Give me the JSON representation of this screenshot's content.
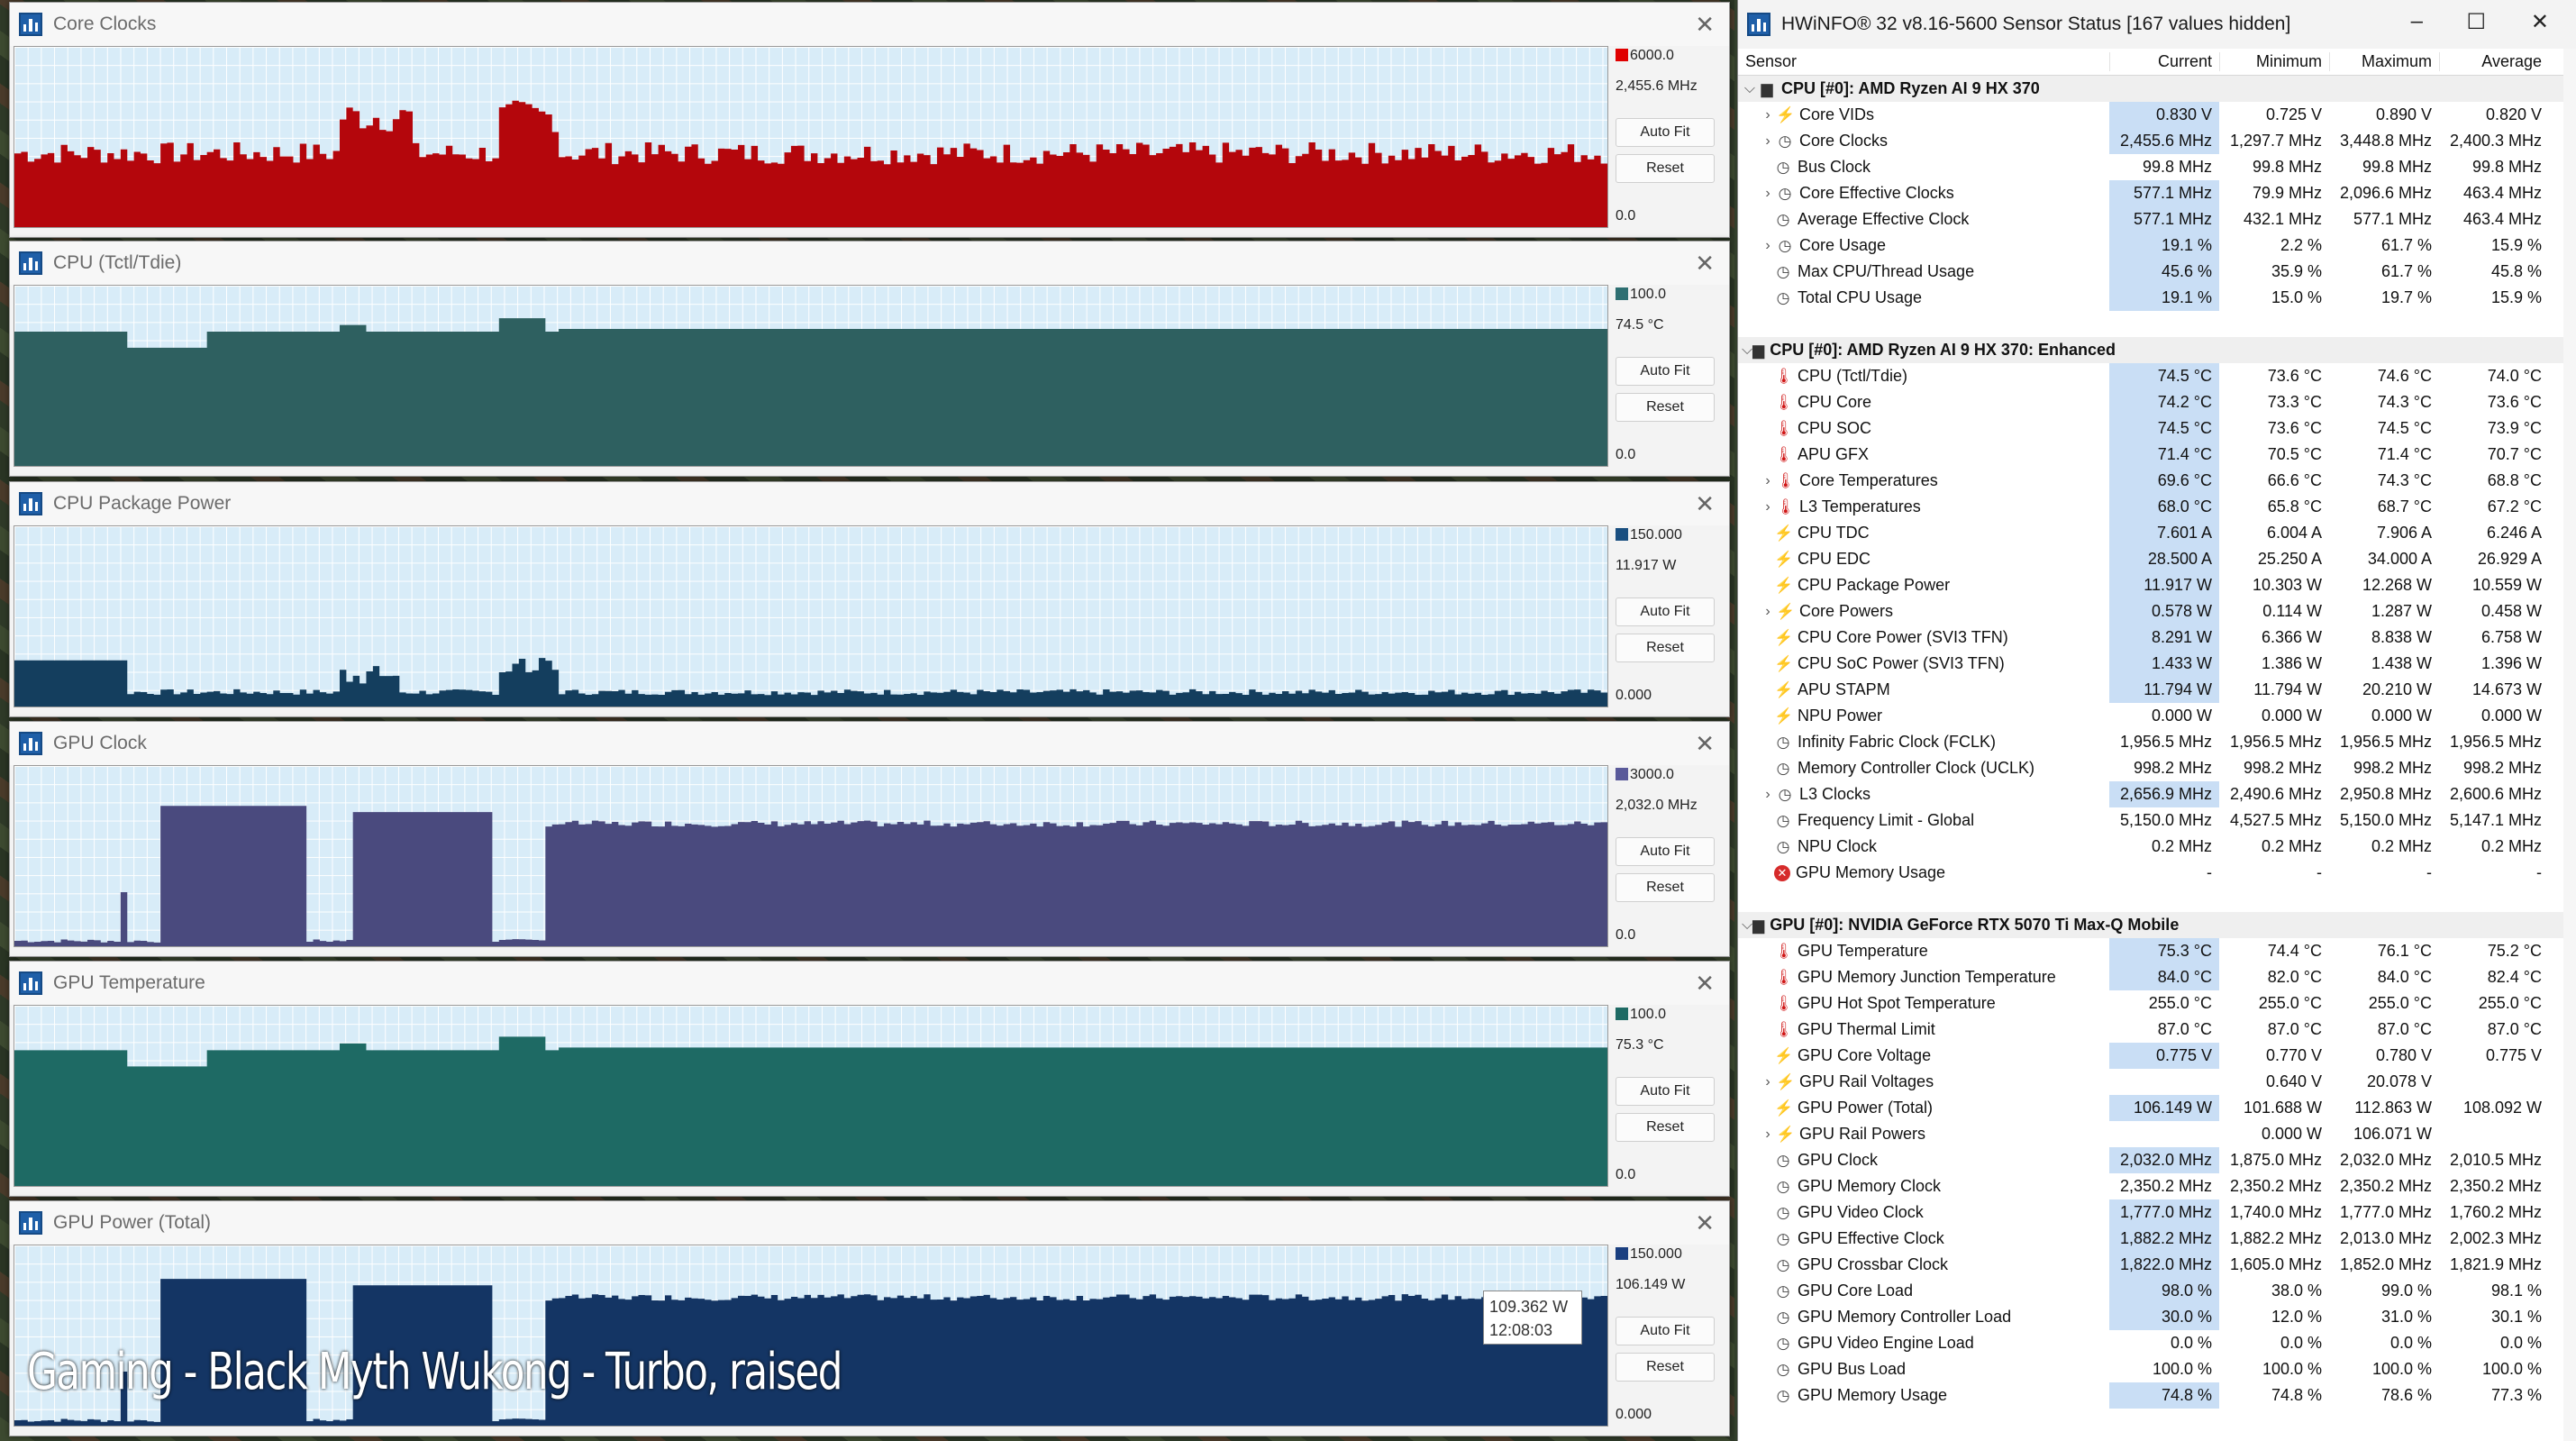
{
  "graphs": [
    {
      "title": "Core Clocks",
      "max": "6000.0",
      "current": "2,455.6 MHz",
      "min": "0.0",
      "color": "#b4060c",
      "swatch": "#e00000",
      "level": 0.41,
      "shape": "noisy",
      "tooltip": null
    },
    {
      "title": "CPU (Tctl/Tdie)",
      "max": "100.0",
      "current": "74.5 °C",
      "min": "0.0",
      "color": "#2e6060",
      "swatch": "#2e6f72",
      "level": 0.745,
      "shape": "temp",
      "tooltip": null
    },
    {
      "title": "CPU Package Power",
      "max": "150.000",
      "current": "11.917 W",
      "min": "0.000",
      "color": "#143e5e",
      "swatch": "#1a4f80",
      "level": 0.08,
      "shape": "power",
      "tooltip": null
    },
    {
      "title": "GPU Clock",
      "max": "3000.0",
      "current": "2,032.0 MHz",
      "min": "0.0",
      "color": "#4a4a7e",
      "swatch": "#5a5a9a",
      "level": 0.677,
      "shape": "gpuclk",
      "tooltip": null
    },
    {
      "title": "GPU Temperature",
      "max": "100.0",
      "current": "75.3 °C",
      "min": "0.0",
      "color": "#1e6a64",
      "swatch": "#1e6a64",
      "level": 0.753,
      "shape": "temp",
      "tooltip": null
    },
    {
      "title": "GPU Power (Total)",
      "max": "150.000",
      "current": "106.149 W",
      "min": "0.000",
      "color": "#143564",
      "swatch": "#1a3f80",
      "level": 0.708,
      "shape": "gpuclk",
      "tooltip": {
        "value": "109.362 W",
        "time": "12:08:03"
      }
    }
  ],
  "graph_buttons": {
    "autofit": "Auto Fit",
    "reset": "Reset"
  },
  "overlay_caption": "Gaming - Black Myth Wukong - Turbo, raised",
  "hwinfo": {
    "title": "HWiNFO® 32 v8.16-5600 Sensor Status [167 values hidden]",
    "columns": [
      "Sensor",
      "Current",
      "Minimum",
      "Maximum",
      "Average"
    ],
    "rows": [
      {
        "t": "grp",
        "name": "CPU [#0]: AMD Ryzen AI 9 HX 370",
        "icon": "chip"
      },
      {
        "t": "sub",
        "name": "Core VIDs",
        "icon": "vol",
        "v": [
          "0.830 V",
          "0.725 V",
          "0.890 V",
          "0.820 V"
        ],
        "hl": true
      },
      {
        "t": "sub",
        "name": "Core Clocks",
        "icon": "clk",
        "v": [
          "2,455.6 MHz",
          "1,297.7 MHz",
          "3,448.8 MHz",
          "2,400.3 MHz"
        ],
        "hl": true
      },
      {
        "t": "item",
        "name": "Bus Clock",
        "icon": "clk",
        "v": [
          "99.8 MHz",
          "99.8 MHz",
          "99.8 MHz",
          "99.8 MHz"
        ],
        "hl": false
      },
      {
        "t": "sub",
        "name": "Core Effective Clocks",
        "icon": "clk",
        "v": [
          "577.1 MHz",
          "79.9 MHz",
          "2,096.6 MHz",
          "463.4 MHz"
        ],
        "hl": true
      },
      {
        "t": "item",
        "name": "Average Effective Clock",
        "icon": "clk",
        "v": [
          "577.1 MHz",
          "432.1 MHz",
          "577.1 MHz",
          "463.4 MHz"
        ],
        "hl": true
      },
      {
        "t": "sub",
        "name": "Core Usage",
        "icon": "clk",
        "v": [
          "19.1 %",
          "2.2 %",
          "61.7 %",
          "15.9 %"
        ],
        "hl": true
      },
      {
        "t": "item",
        "name": "Max CPU/Thread Usage",
        "icon": "clk",
        "v": [
          "45.6 %",
          "35.9 %",
          "61.7 %",
          "45.8 %"
        ],
        "hl": true
      },
      {
        "t": "item",
        "name": "Total CPU Usage",
        "icon": "clk",
        "v": [
          "19.1 %",
          "15.0 %",
          "19.7 %",
          "15.9 %"
        ],
        "hl": true
      },
      {
        "t": "gap"
      },
      {
        "t": "grp",
        "name": "CPU [#0]: AMD Ryzen AI 9 HX 370: Enhanced",
        "icon": "chip"
      },
      {
        "t": "item",
        "name": "CPU (Tctl/Tdie)",
        "icon": "tmp",
        "v": [
          "74.5 °C",
          "73.6 °C",
          "74.6 °C",
          "74.0 °C"
        ],
        "hl": true
      },
      {
        "t": "item",
        "name": "CPU Core",
        "icon": "tmp",
        "v": [
          "74.2 °C",
          "73.3 °C",
          "74.3 °C",
          "73.6 °C"
        ],
        "hl": true
      },
      {
        "t": "item",
        "name": "CPU SOC",
        "icon": "tmp",
        "v": [
          "74.5 °C",
          "73.6 °C",
          "74.5 °C",
          "73.9 °C"
        ],
        "hl": true
      },
      {
        "t": "item",
        "name": "APU GFX",
        "icon": "tmp",
        "v": [
          "71.4 °C",
          "70.5 °C",
          "71.4 °C",
          "70.7 °C"
        ],
        "hl": true
      },
      {
        "t": "sub",
        "name": "Core Temperatures",
        "icon": "tmp",
        "v": [
          "69.6 °C",
          "66.6 °C",
          "74.3 °C",
          "68.8 °C"
        ],
        "hl": true
      },
      {
        "t": "sub",
        "name": "L3 Temperatures",
        "icon": "tmp",
        "v": [
          "68.0 °C",
          "65.8 °C",
          "68.7 °C",
          "67.2 °C"
        ],
        "hl": true
      },
      {
        "t": "item",
        "name": "CPU TDC",
        "icon": "vol",
        "v": [
          "7.601 A",
          "6.004 A",
          "7.906 A",
          "6.246 A"
        ],
        "hl": true
      },
      {
        "t": "item",
        "name": "CPU EDC",
        "icon": "vol",
        "v": [
          "28.500 A",
          "25.250 A",
          "34.000 A",
          "26.929 A"
        ],
        "hl": true
      },
      {
        "t": "item",
        "name": "CPU Package Power",
        "icon": "vol",
        "v": [
          "11.917 W",
          "10.303 W",
          "12.268 W",
          "10.559 W"
        ],
        "hl": true
      },
      {
        "t": "sub",
        "name": "Core Powers",
        "icon": "vol",
        "v": [
          "0.578 W",
          "0.114 W",
          "1.287 W",
          "0.458 W"
        ],
        "hl": true
      },
      {
        "t": "item",
        "name": "CPU Core Power (SVI3 TFN)",
        "icon": "vol",
        "v": [
          "8.291 W",
          "6.366 W",
          "8.838 W",
          "6.758 W"
        ],
        "hl": true
      },
      {
        "t": "item",
        "name": "CPU SoC Power (SVI3 TFN)",
        "icon": "vol",
        "v": [
          "1.433 W",
          "1.386 W",
          "1.438 W",
          "1.396 W"
        ],
        "hl": true
      },
      {
        "t": "item",
        "name": "APU STAPM",
        "icon": "vol",
        "v": [
          "11.794 W",
          "11.794 W",
          "20.210 W",
          "14.673 W"
        ],
        "hl": true
      },
      {
        "t": "item",
        "name": "NPU Power",
        "icon": "vol",
        "v": [
          "0.000 W",
          "0.000 W",
          "0.000 W",
          "0.000 W"
        ],
        "hl": false
      },
      {
        "t": "item",
        "name": "Infinity Fabric Clock (FCLK)",
        "icon": "clk",
        "v": [
          "1,956.5 MHz",
          "1,956.5 MHz",
          "1,956.5 MHz",
          "1,956.5 MHz"
        ],
        "hl": false
      },
      {
        "t": "item",
        "name": "Memory Controller Clock (UCLK)",
        "icon": "clk",
        "v": [
          "998.2 MHz",
          "998.2 MHz",
          "998.2 MHz",
          "998.2 MHz"
        ],
        "hl": false
      },
      {
        "t": "sub",
        "name": "L3 Clocks",
        "icon": "clk",
        "v": [
          "2,656.9 MHz",
          "2,490.6 MHz",
          "2,950.8 MHz",
          "2,600.6 MHz"
        ],
        "hl": true
      },
      {
        "t": "item",
        "name": "Frequency Limit - Global",
        "icon": "clk",
        "v": [
          "5,150.0 MHz",
          "4,527.5 MHz",
          "5,150.0 MHz",
          "5,147.1 MHz"
        ],
        "hl": false
      },
      {
        "t": "item",
        "name": "NPU Clock",
        "icon": "clk",
        "v": [
          "0.2 MHz",
          "0.2 MHz",
          "0.2 MHz",
          "0.2 MHz"
        ],
        "hl": false
      },
      {
        "t": "item",
        "name": "GPU Memory Usage",
        "icon": "err",
        "v": [
          "-",
          "-",
          "-",
          "-"
        ],
        "hl": false
      },
      {
        "t": "gap"
      },
      {
        "t": "grp",
        "name": "GPU [#0]: NVIDIA  GeForce RTX 5070 Ti Max-Q Mobile",
        "icon": "chip"
      },
      {
        "t": "item",
        "name": "GPU Temperature",
        "icon": "tmp",
        "v": [
          "75.3 °C",
          "74.4 °C",
          "76.1 °C",
          "75.2 °C"
        ],
        "hl": true
      },
      {
        "t": "item",
        "name": "GPU Memory Junction Temperature",
        "icon": "tmp",
        "v": [
          "84.0 °C",
          "82.0 °C",
          "84.0 °C",
          "82.4 °C"
        ],
        "hl": true
      },
      {
        "t": "item",
        "name": "GPU Hot Spot Temperature",
        "icon": "tmp",
        "v": [
          "255.0 °C",
          "255.0 °C",
          "255.0 °C",
          "255.0 °C"
        ],
        "hl": false
      },
      {
        "t": "item",
        "name": "GPU Thermal Limit",
        "icon": "tmp",
        "v": [
          "87.0 °C",
          "87.0 °C",
          "87.0 °C",
          "87.0 °C"
        ],
        "hl": false
      },
      {
        "t": "item",
        "name": "GPU Core Voltage",
        "icon": "vol",
        "v": [
          "0.775 V",
          "0.770 V",
          "0.780 V",
          "0.775 V"
        ],
        "hl": true
      },
      {
        "t": "sub",
        "name": "GPU Rail Voltages",
        "icon": "vol",
        "v": [
          "",
          "0.640 V",
          "20.078 V",
          ""
        ],
        "hl": false
      },
      {
        "t": "item",
        "name": "GPU Power (Total)",
        "icon": "vol",
        "v": [
          "106.149 W",
          "101.688 W",
          "112.863 W",
          "108.092 W"
        ],
        "hl": true
      },
      {
        "t": "sub",
        "name": "GPU Rail Powers",
        "icon": "vol",
        "v": [
          "",
          "0.000 W",
          "106.071 W",
          ""
        ],
        "hl": false
      },
      {
        "t": "item",
        "name": "GPU Clock",
        "icon": "clk",
        "v": [
          "2,032.0 MHz",
          "1,875.0 MHz",
          "2,032.0 MHz",
          "2,010.5 MHz"
        ],
        "hl": true
      },
      {
        "t": "item",
        "name": "GPU Memory Clock",
        "icon": "clk",
        "v": [
          "2,350.2 MHz",
          "2,350.2 MHz",
          "2,350.2 MHz",
          "2,350.2 MHz"
        ],
        "hl": false
      },
      {
        "t": "item",
        "name": "GPU Video Clock",
        "icon": "clk",
        "v": [
          "1,777.0 MHz",
          "1,740.0 MHz",
          "1,777.0 MHz",
          "1,760.2 MHz"
        ],
        "hl": true
      },
      {
        "t": "item",
        "name": "GPU Effective Clock",
        "icon": "clk",
        "v": [
          "1,882.2 MHz",
          "1,882.2 MHz",
          "2,013.0 MHz",
          "2,002.3 MHz"
        ],
        "hl": true
      },
      {
        "t": "item",
        "name": "GPU Crossbar Clock",
        "icon": "clk",
        "v": [
          "1,822.0 MHz",
          "1,605.0 MHz",
          "1,852.0 MHz",
          "1,821.9 MHz"
        ],
        "hl": true
      },
      {
        "t": "item",
        "name": "GPU Core Load",
        "icon": "clk",
        "v": [
          "98.0 %",
          "38.0 %",
          "99.0 %",
          "98.1 %"
        ],
        "hl": true
      },
      {
        "t": "item",
        "name": "GPU Memory Controller Load",
        "icon": "clk",
        "v": [
          "30.0 %",
          "12.0 %",
          "31.0 %",
          "30.1 %"
        ],
        "hl": true
      },
      {
        "t": "item",
        "name": "GPU Video Engine Load",
        "icon": "clk",
        "v": [
          "0.0 %",
          "0.0 %",
          "0.0 %",
          "0.0 %"
        ],
        "hl": false
      },
      {
        "t": "item",
        "name": "GPU Bus Load",
        "icon": "clk",
        "v": [
          "100.0 %",
          "100.0 %",
          "100.0 %",
          "100.0 %"
        ],
        "hl": false
      },
      {
        "t": "item",
        "name": "GPU Memory Usage",
        "icon": "clk",
        "v": [
          "74.8 %",
          "74.8 %",
          "78.6 %",
          "77.3 %"
        ],
        "hl": true
      }
    ]
  }
}
